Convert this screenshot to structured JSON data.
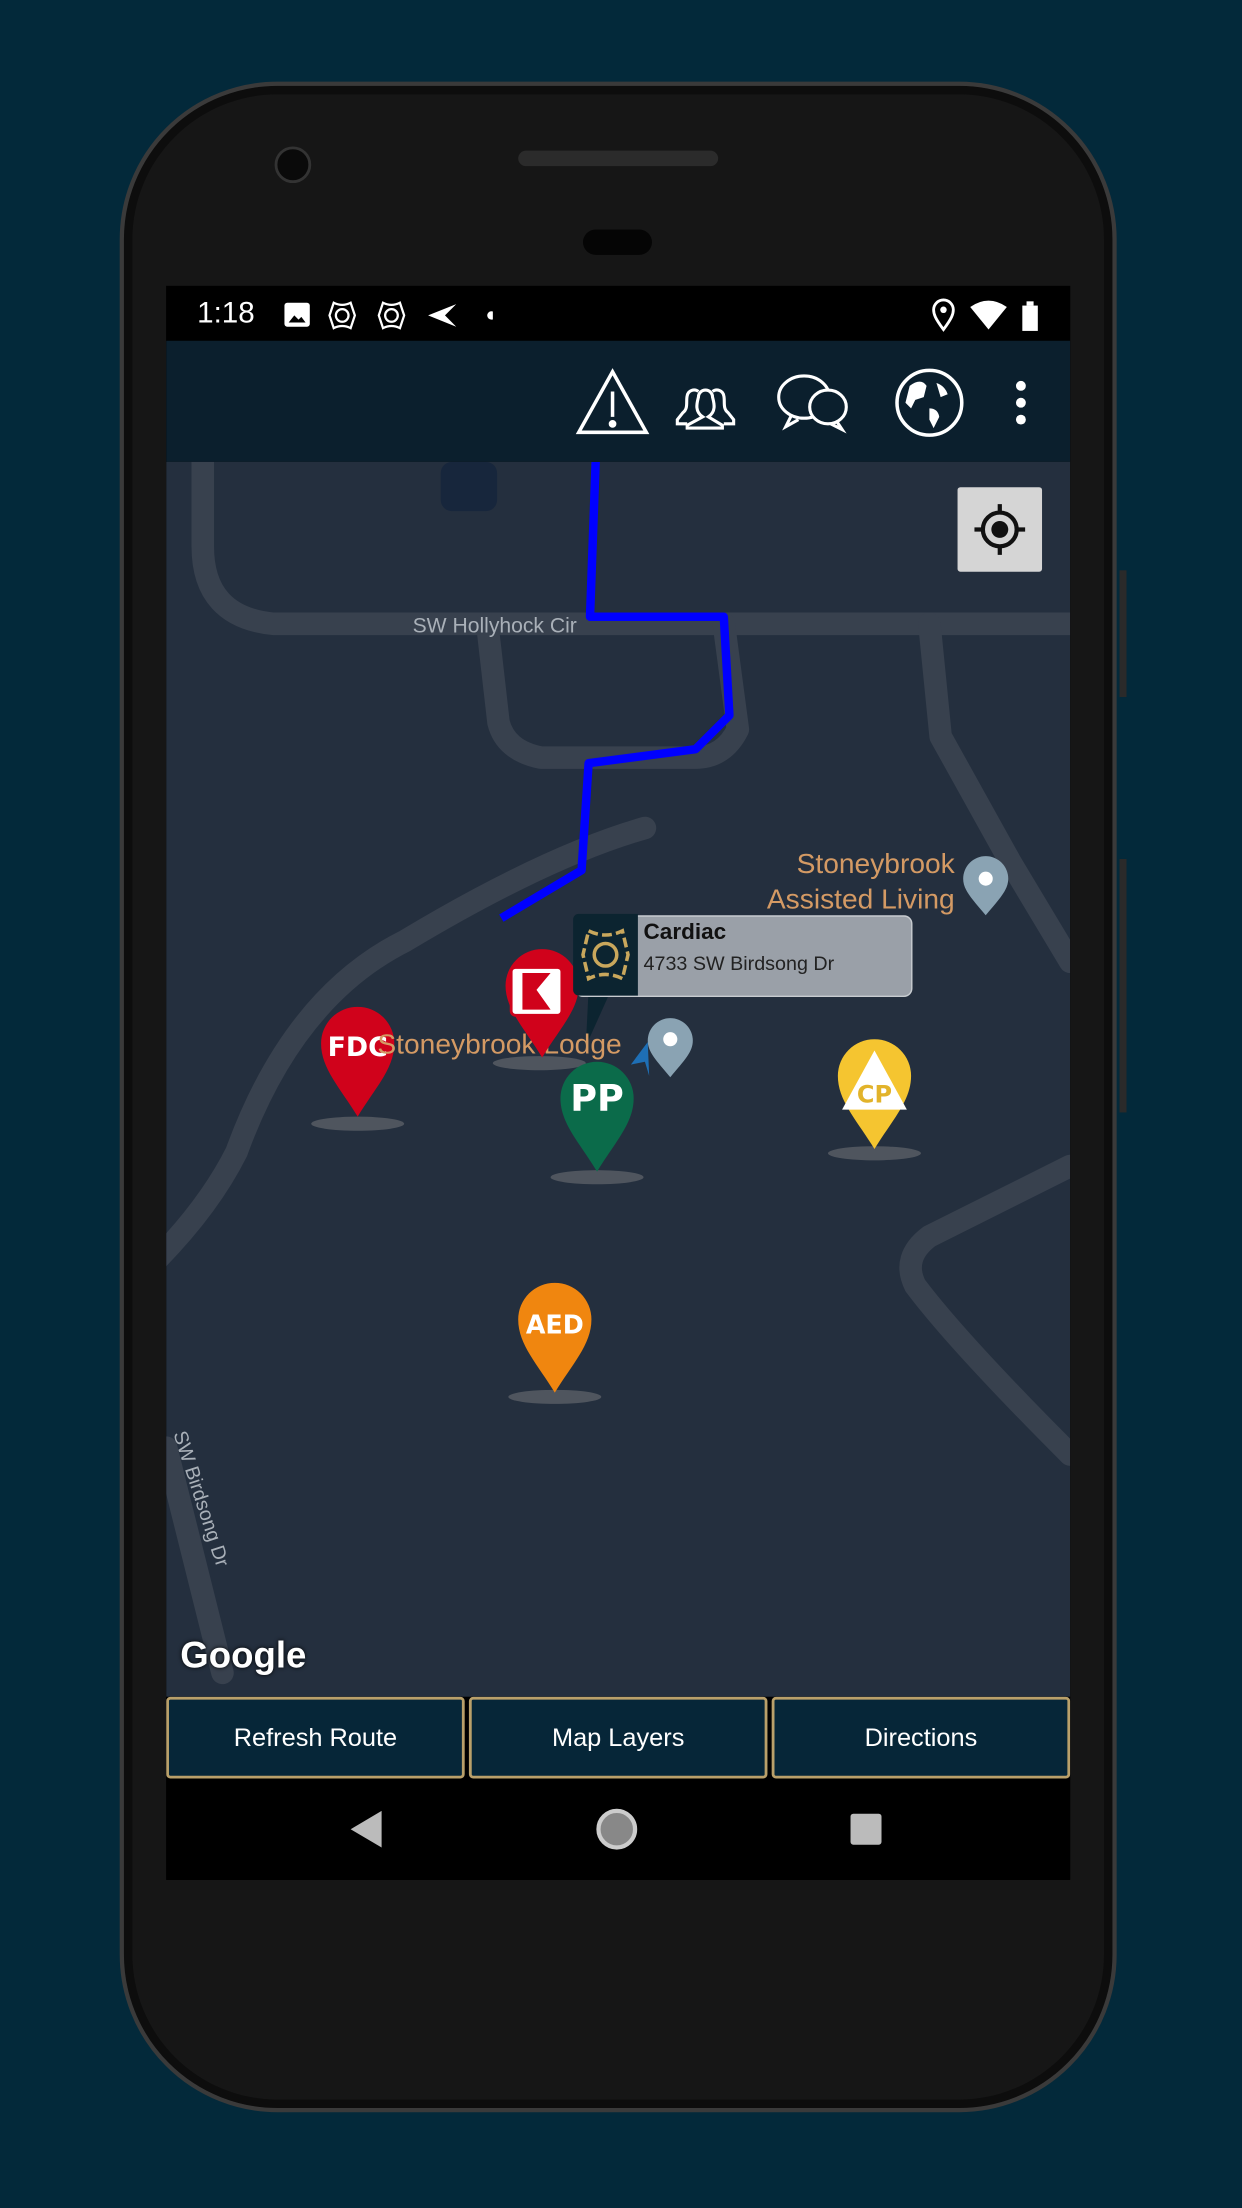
{
  "status_bar": {
    "time": "1:18",
    "left_icons": [
      "image-icon",
      "fire-badge-icon",
      "fire-badge-icon",
      "send-icon",
      "dot-icon"
    ],
    "right_icons": [
      "location-icon",
      "wifi-icon",
      "battery-icon"
    ]
  },
  "app_bar": {
    "actions": [
      "warning-icon",
      "group-icon",
      "chat-icon",
      "globe-icon",
      "more-vert-icon"
    ]
  },
  "map": {
    "street_labels": [
      "SW Hollyhock Cir",
      "SW Birdsong Dr"
    ],
    "poi_labels": {
      "assisted_living": "Stoneybrook\nAssisted Living",
      "lodge": "Stoneybrook Lodge"
    },
    "attribution": "Google",
    "route_color": "#0000ff",
    "callout": {
      "title": "Cardiac",
      "address": "4733 SW Birdsong Dr"
    },
    "markers": [
      {
        "label": "FDC",
        "color": "#d0021b"
      },
      {
        "label": "",
        "icon": "knox-box-icon",
        "color": "#d0021b"
      },
      {
        "label": "PP",
        "color": "#0b6b4a"
      },
      {
        "label": "CP",
        "color": "#f5c530"
      },
      {
        "label": "AED",
        "color": "#f0860f"
      }
    ]
  },
  "buttons": {
    "refresh": "Refresh Route",
    "layers": "Map Layers",
    "directions": "Directions"
  },
  "colors": {
    "accent_gold": "#b9a06a",
    "app_bar": "#0b1f2d",
    "map_bg": "#242f3e"
  }
}
